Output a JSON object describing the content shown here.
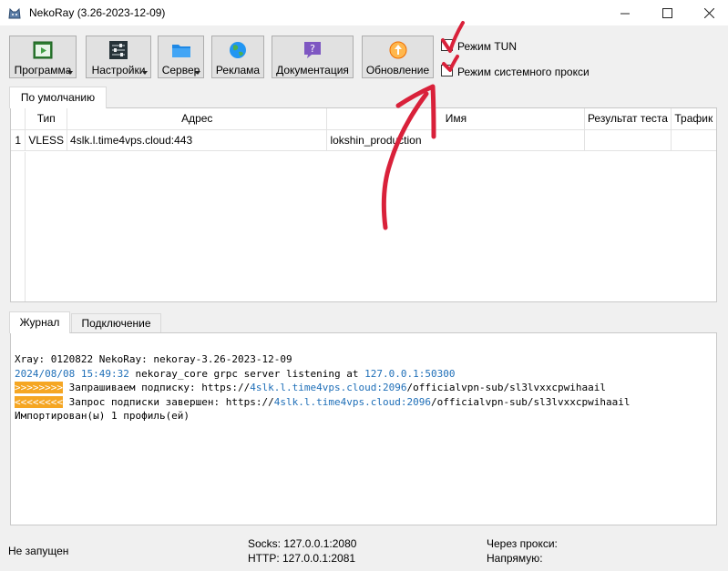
{
  "window": {
    "title": "NekoRay (3.26-2023-12-09)"
  },
  "toolbar": {
    "program": "Программа",
    "settings": "Настройки",
    "server": "Сервер",
    "ads": "Реклама",
    "docs": "Документация",
    "update": "Обновление"
  },
  "options": {
    "tun_mode": "Режим TUN",
    "system_proxy": "Режим системного прокси"
  },
  "groups": {
    "default_tab": "По умолчанию"
  },
  "server_table": {
    "columns": [
      "Тип",
      "Адрес",
      "Имя",
      "Результат теста",
      "Трафик"
    ],
    "rows": [
      {
        "index": "1",
        "type": "VLESS",
        "address": "4slk.l.time4vps.cloud:443",
        "name": "lokshin_production",
        "test": "",
        "traffic": ""
      }
    ]
  },
  "bottom_tabs": {
    "log": "Журнал",
    "connections": "Подключение"
  },
  "log": {
    "line1": "Xray: 0120822 NekoRay: nekoray-3.26-2023-12-09",
    "line2_ts": "2024/08/08 15:49:32",
    "line2_mid": " nekoray_core grpc server listening at ",
    "line2_addr": "127.0.0.1:50300",
    "line3_tag": ">>>>>>>>",
    "line3_text": " Запрашиваем подписку: https://",
    "line3_url": "4slk.l.time4vps.cloud:2096",
    "line3_rest": "/officialvpn-sub/sl3lvxxcpwihaail",
    "line4_tag": "<<<<<<<<",
    "line4_text": " Запрос подписки завершен: https://",
    "line4_url": "4slk.l.time4vps.cloud:2096",
    "line4_rest": "/officialvpn-sub/sl3lvxxcpwihaail",
    "line5": "Импортирован(ы) 1 профиль(ей)"
  },
  "statusbar": {
    "state": "Не запущен",
    "socks": "Socks: 127.0.0.1:2080",
    "http": "HTTP: 127.0.0.1:2081",
    "via_proxy": "Через прокси:",
    "direct": "Напрямую:"
  },
  "colors": {
    "annotation": "#d9213a",
    "log_blue": "#1f6fb8",
    "log_tag": "#f5a623"
  },
  "icons": {
    "app": "nekoray-cat-icon",
    "program": "play-window-icon",
    "settings": "sliders-icon",
    "server": "folder-icon",
    "ads": "globe-icon",
    "docs": "question-bubble-icon",
    "update": "update-circle-icon"
  }
}
